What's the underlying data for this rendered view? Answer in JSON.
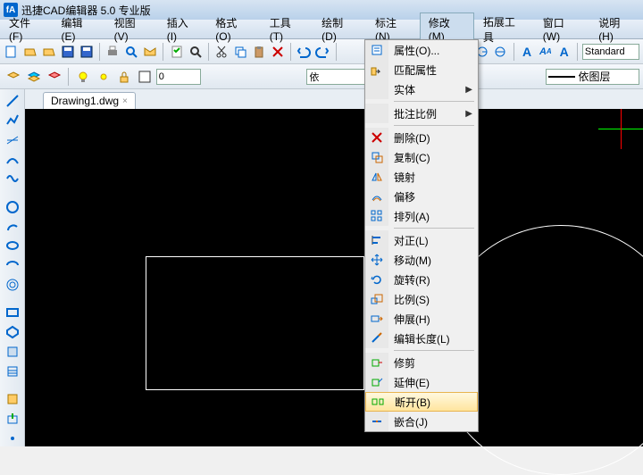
{
  "title": "迅捷CAD编辑器 5.0 专业版",
  "menu": [
    "文件(F)",
    "编辑(E)",
    "视图(V)",
    "插入(I)",
    "格式(O)",
    "工具(T)",
    "绘制(D)",
    "标注(N)",
    "修改(M)",
    "拓展工具",
    "窗口(W)",
    "说明(H)"
  ],
  "input0": "0",
  "combo1": "依",
  "combo2": "依图层",
  "combo3": "Standard",
  "tab": "Drawing1.dwg",
  "dd": {
    "g1": [
      "属性(O)...",
      "匹配属性",
      "实体",
      "",
      "批注比例"
    ],
    "g2": [
      "删除(D)",
      "复制(C)",
      "镜射",
      "偏移",
      "排列(A)"
    ],
    "g3": [
      "对正(L)",
      "移动(M)",
      "旋转(R)",
      "比例(S)",
      "伸展(H)",
      "编辑长度(L)"
    ],
    "g4": [
      "修剪",
      "延伸(E)",
      "断开(B)",
      "嵌合(J)"
    ]
  }
}
